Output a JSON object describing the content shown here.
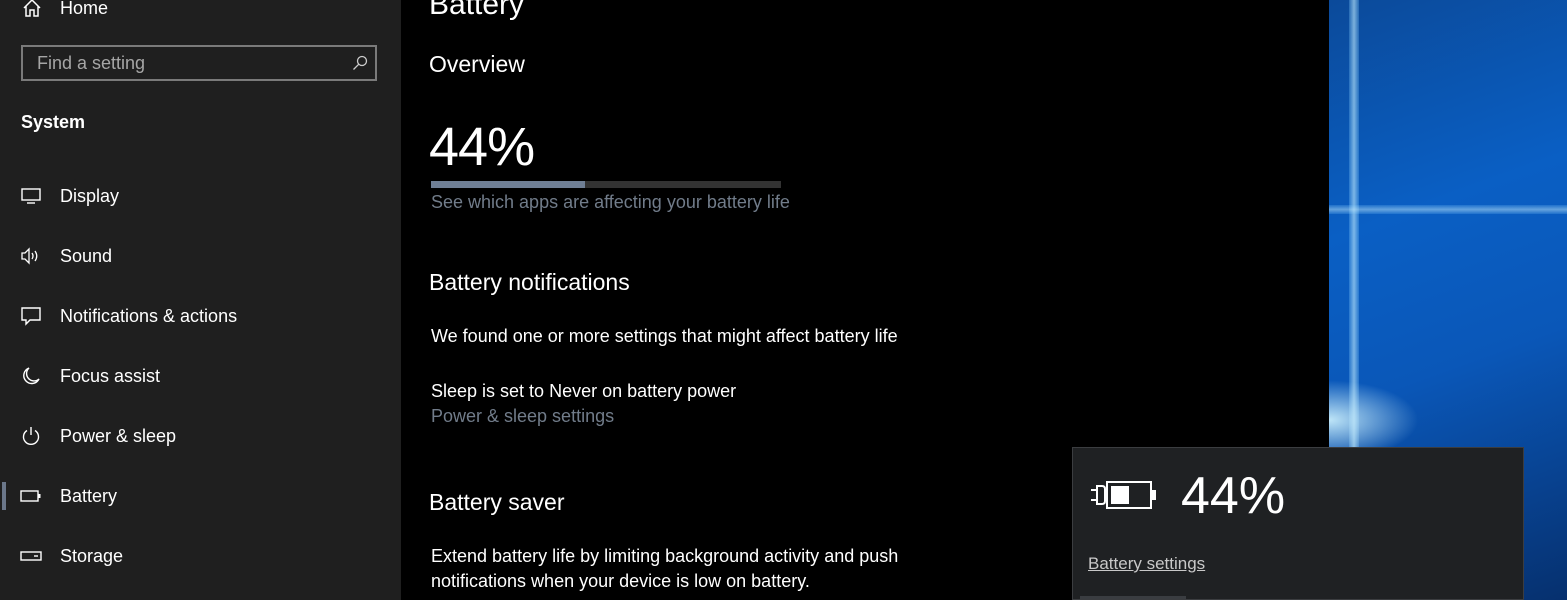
{
  "sidebar": {
    "home_label": "Home",
    "search_placeholder": "Find a setting",
    "section_title": "System",
    "items": [
      {
        "label": "Display",
        "icon": "display-icon"
      },
      {
        "label": "Sound",
        "icon": "sound-icon"
      },
      {
        "label": "Notifications & actions",
        "icon": "notifications-icon"
      },
      {
        "label": "Focus assist",
        "icon": "moon-icon"
      },
      {
        "label": "Power & sleep",
        "icon": "power-icon"
      },
      {
        "label": "Battery",
        "icon": "battery-icon",
        "selected": true
      },
      {
        "label": "Storage",
        "icon": "storage-icon"
      }
    ]
  },
  "main": {
    "title": "Battery",
    "overview": {
      "heading": "Overview",
      "percent_text": "44%",
      "percent_value": 44,
      "apps_link": "See which apps are affecting your battery life"
    },
    "notifications": {
      "heading": "Battery notifications",
      "message": "We found one or more settings that might affect battery life",
      "sleep_text": "Sleep is set to Never on battery power",
      "power_link": "Power & sleep settings"
    },
    "saver": {
      "heading": "Battery saver",
      "description_line1": "Extend battery life by limiting background activity and push",
      "description_line2": "notifications when your device is low on battery."
    }
  },
  "flyout": {
    "percent_text": "44%",
    "settings_link": "Battery settings",
    "icon": "battery-charging-icon"
  },
  "colors": {
    "sidebar_bg": "#1f1f1f",
    "main_bg": "#000000",
    "accent": "#6f7f95",
    "link": "#717c8a"
  }
}
